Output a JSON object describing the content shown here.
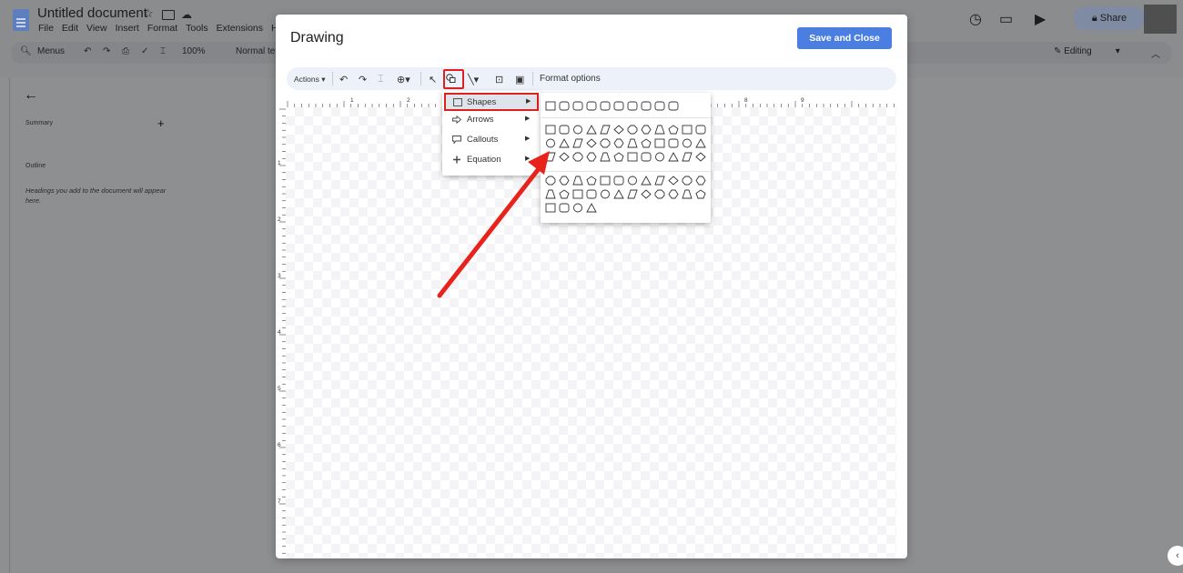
{
  "doc": {
    "title": "Untitled document",
    "menus": [
      "File",
      "Edit",
      "View",
      "Insert",
      "Format",
      "Tools",
      "Extensions",
      "H"
    ],
    "search_label": "Menus",
    "zoom": "100%",
    "style": "Normal te",
    "mode": "Editing",
    "share_label": "Share"
  },
  "sidebar": {
    "summary_label": "Summary",
    "outline_label": "Outline",
    "outline_desc": "Headings you add to the document will appear here."
  },
  "drawing": {
    "title": "Drawing",
    "save_label": "Save and Close",
    "actions_label": "Actions ▾",
    "format_label": "Format options",
    "ruler_top": [
      "1",
      "2",
      "8",
      "9"
    ],
    "ruler_left": [
      "1",
      "2",
      "3",
      "4",
      "5",
      "6",
      "7"
    ]
  },
  "menu": {
    "items": [
      {
        "label": "Shapes",
        "icon": "square-icon"
      },
      {
        "label": "Arrows",
        "icon": "arrow-icon"
      },
      {
        "label": "Callouts",
        "icon": "callout-icon"
      },
      {
        "label": "Equation",
        "icon": "plus-icon"
      }
    ]
  },
  "colors": {
    "accent": "#4a7ee0",
    "highlight": "#e02020"
  }
}
